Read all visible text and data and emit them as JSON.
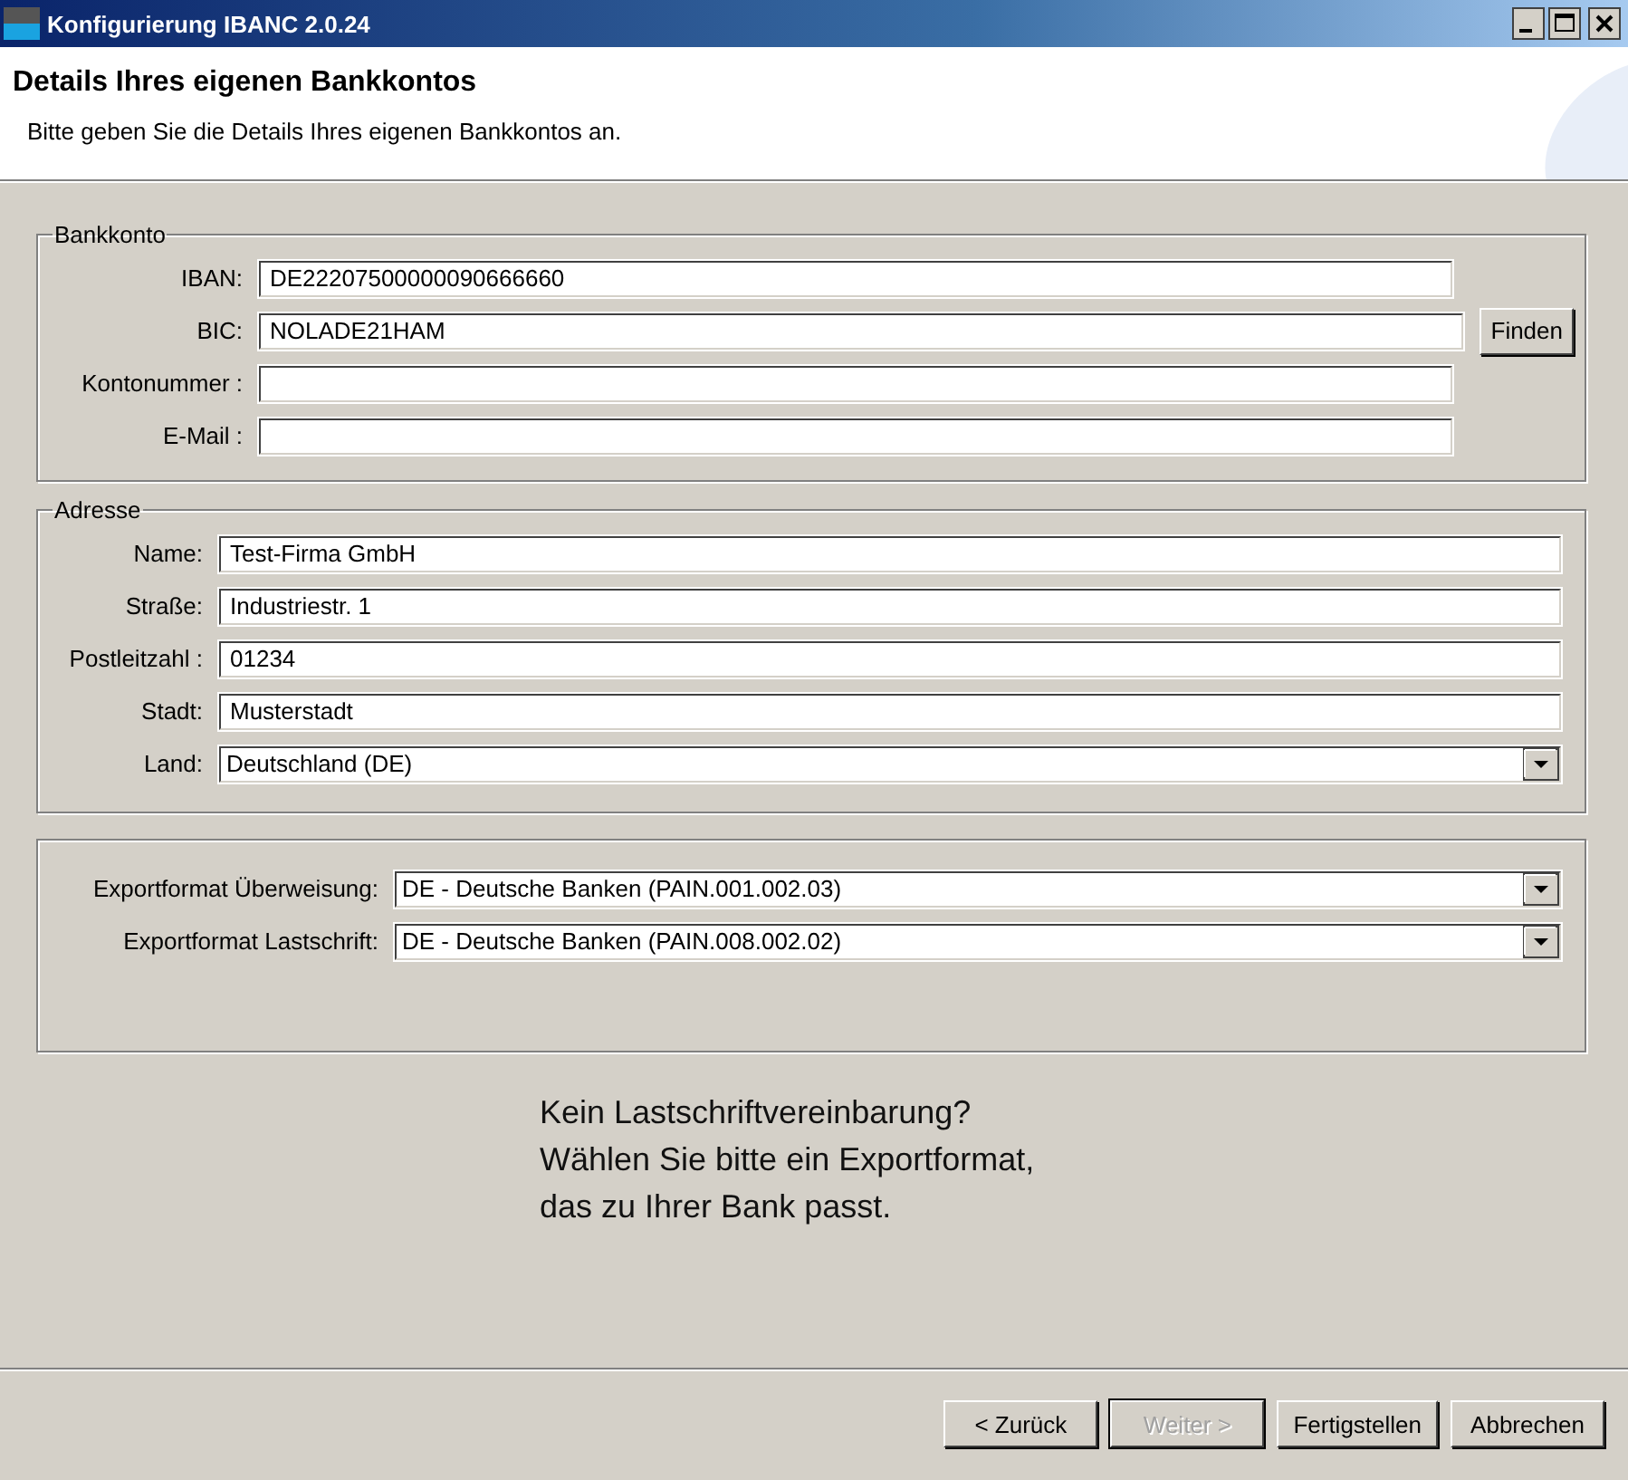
{
  "window": {
    "title": "Konfigurierung IBANC 2.0.24"
  },
  "header": {
    "title": "Details Ihres eigenen Bankkontos",
    "subtitle": "Bitte geben Sie die Details Ihres eigenen Bankkontos an."
  },
  "bank_account": {
    "legend": "Bankkonto",
    "fields": [
      {
        "label": "IBAN:",
        "value": "DE22207500000090666660",
        "kind": "text"
      },
      {
        "label": "BIC:",
        "value": "NOLADE21HAM",
        "kind": "text"
      },
      {
        "label": "Kontonummer :",
        "kind": "text"
      },
      {
        "label": "E-Mail :",
        "kind": "text"
      }
    ],
    "find_button": "Finden"
  },
  "address": {
    "legend": "Adresse",
    "fields": [
      {
        "label": "Name:",
        "value": "Test-Firma GmbH",
        "kind": "text"
      },
      {
        "label": "Straße:",
        "value": "Industriestr. 1",
        "kind": "text"
      },
      {
        "label": "Postleitzahl :",
        "value": "01234",
        "kind": "text"
      },
      {
        "label": "Stadt:",
        "value": "Musterstadt",
        "kind": "text"
      },
      {
        "label": "Land:",
        "value": "Deutschland (DE)",
        "kind": "dropdown"
      }
    ]
  },
  "export": {
    "fields": [
      {
        "label": "Exportformat Überweisung:",
        "value": "DE - Deutsche Banken (PAIN.001.002.03)",
        "kind": "dropdown"
      },
      {
        "label": "Exportformat Lastschrift:",
        "value": "DE - Deutsche Banken (PAIN.008.002.02)",
        "kind": "dropdown"
      }
    ]
  },
  "message": [
    "Kein Lastschriftvereinbarung?",
    "Wählen Sie bitte ein Exportformat,",
    "das zu Ihrer Bank passt."
  ],
  "buttons": [
    {
      "label": "< Zurück",
      "disabled": false,
      "focused": false
    },
    {
      "label": "Weiter >",
      "disabled": true,
      "focused": true
    },
    {
      "label": "Fertigstellen",
      "disabled": false,
      "focused": false
    },
    {
      "label": "Abbrechen",
      "disabled": false,
      "focused": false
    }
  ]
}
